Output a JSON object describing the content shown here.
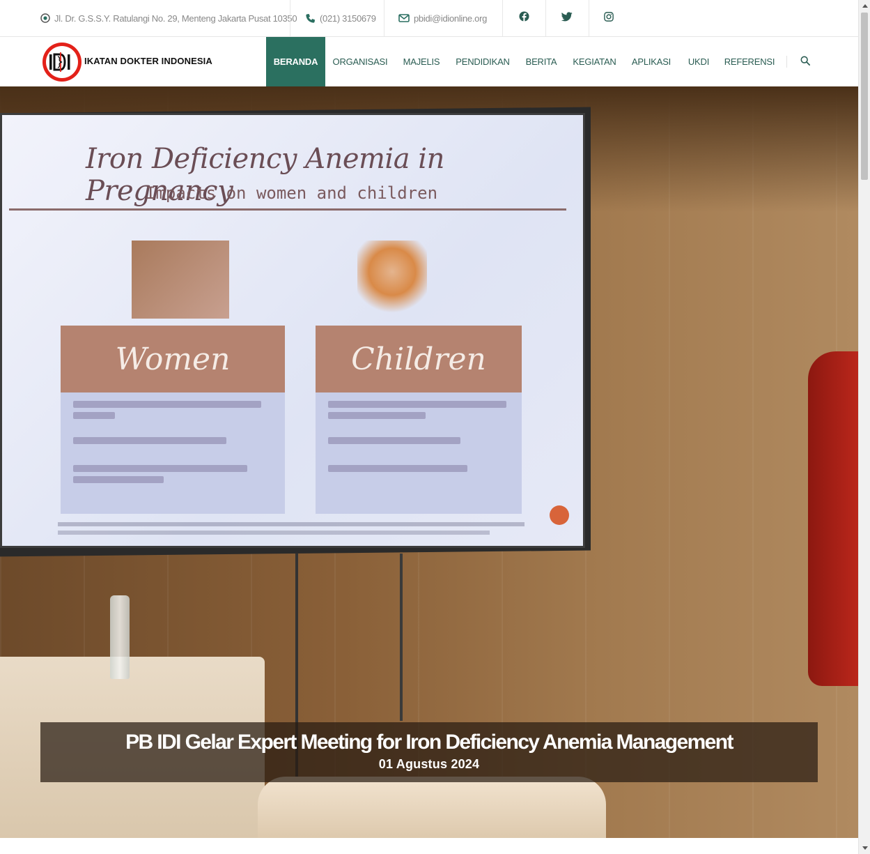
{
  "topbar": {
    "address": "Jl. Dr. G.S.S.Y. Ratulangi No. 29, Menteng Jakarta Pusat 10350",
    "phone": "(021) 3150679",
    "email": "pbidi@idionline.org",
    "socials": [
      "facebook-icon",
      "twitter-icon",
      "instagram-icon"
    ]
  },
  "brand": {
    "name": "IKATAN DOKTER INDONESIA",
    "logo_text": "IDI"
  },
  "nav": {
    "items": [
      {
        "label": "BERANDA",
        "active": true
      },
      {
        "label": "ORGANISASI"
      },
      {
        "label": "MAJELIS"
      },
      {
        "label": "PENDIDIKAN"
      },
      {
        "label": "BERITA"
      },
      {
        "label": "KEGIATAN"
      },
      {
        "label": "APLIKASI"
      },
      {
        "label": "UKDI"
      },
      {
        "label": "REFERENSI"
      }
    ]
  },
  "hero": {
    "slide": {
      "title": "Iron Deficiency Anemia in Pregnancy",
      "subtitle": "Impacts on women and children",
      "box_left": "Women",
      "box_right": "Children"
    },
    "caption_title": "PB IDI Gelar Expert Meeting for Iron Deficiency Anemia Management",
    "caption_date": "01 Agustus 2024"
  },
  "colors": {
    "accent": "#2b7060",
    "nav_text": "#2a5c52",
    "logo_red": "#e32119"
  }
}
